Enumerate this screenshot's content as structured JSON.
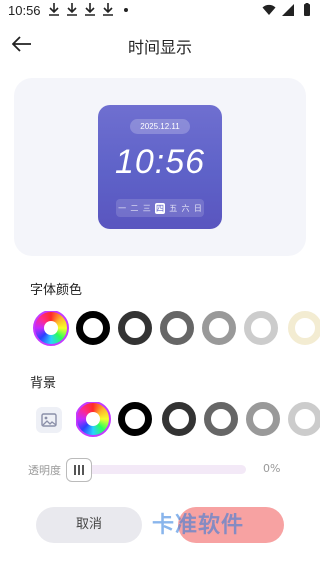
{
  "status_bar": {
    "time": "10:56"
  },
  "header": {
    "title": "时间显示"
  },
  "preview": {
    "date": "2025.12.11",
    "time": "10:56",
    "weekdays": [
      "一",
      "二",
      "三",
      "四",
      "五",
      "六",
      "日"
    ],
    "active_weekday_index": 3
  },
  "font_color": {
    "label": "字体颜色",
    "swatches": [
      "color-wheel",
      "#000000",
      "#333333",
      "#666666",
      "#999999",
      "#cccccc"
    ]
  },
  "background": {
    "label": "背景",
    "swatches": [
      "image-picker",
      "color-wheel",
      "#000000",
      "#333333",
      "#666666",
      "#999999"
    ]
  },
  "opacity": {
    "label": "透明度",
    "value": "0%",
    "level": 0
  },
  "actions": {
    "cancel_label": "取消"
  },
  "watermark": "卡准软件",
  "colors": {
    "accent_purple": "#5e62c8",
    "confirm_pink": "#f7a2a2",
    "card_bg": "#f4f5fa"
  }
}
